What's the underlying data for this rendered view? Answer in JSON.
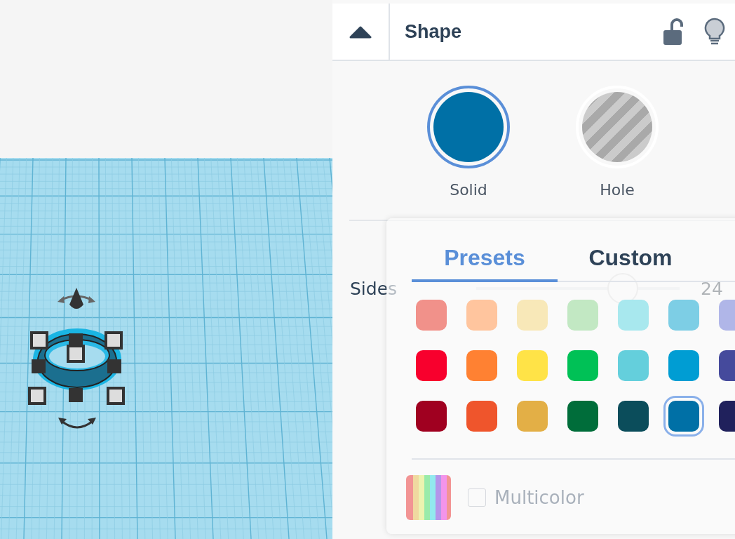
{
  "inspector": {
    "title": "Shape"
  },
  "shape_modes": [
    {
      "label": "Solid",
      "kind": "solid",
      "selected": true
    },
    {
      "label": "Hole",
      "kind": "hole",
      "selected": false
    }
  ],
  "properties": [
    {
      "label": "Sides",
      "level": 0.72,
      "value": "24"
    }
  ],
  "color_picker": {
    "tabs": [
      {
        "label": "Presets",
        "selected": true
      },
      {
        "label": "Custom",
        "selected": false
      }
    ],
    "swatches": [
      {
        "color": "#f1918a",
        "selected": false
      },
      {
        "color": "#ffc59e",
        "selected": false
      },
      {
        "color": "#f8e8b8",
        "selected": false
      },
      {
        "color": "#c2e8c3",
        "selected": false
      },
      {
        "color": "#a8e8ee",
        "selected": false
      },
      {
        "color": "#7dcee5",
        "selected": false
      },
      {
        "color": "#b0b6e8",
        "selected": false
      },
      {
        "color": "#f8002d",
        "selected": false
      },
      {
        "color": "#ff8132",
        "selected": false
      },
      {
        "color": "#ffe347",
        "selected": false
      },
      {
        "color": "#00c156",
        "selected": false
      },
      {
        "color": "#64cfdc",
        "selected": false
      },
      {
        "color": "#009dd3",
        "selected": false
      },
      {
        "color": "#454a9c",
        "selected": false
      },
      {
        "color": "#a00020",
        "selected": false
      },
      {
        "color": "#ef552c",
        "selected": false
      },
      {
        "color": "#e3af46",
        "selected": false
      },
      {
        "color": "#006d3a",
        "selected": false
      },
      {
        "color": "#0b4d5b",
        "selected": false
      },
      {
        "color": "#0070a6",
        "selected": true
      },
      {
        "color": "#20215c",
        "selected": false
      }
    ],
    "multicolor": {
      "label": "Multicolor",
      "checked": false
    }
  }
}
